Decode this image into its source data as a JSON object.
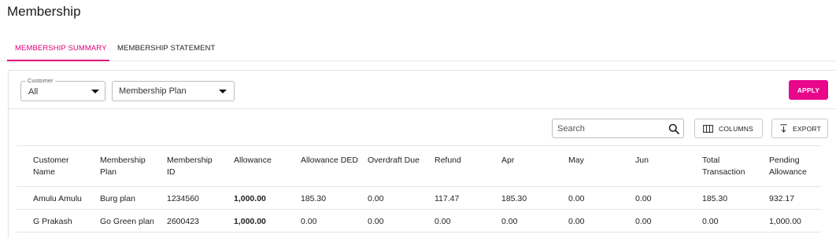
{
  "page": {
    "title": "Membership"
  },
  "tabs": [
    {
      "label": "MEMBERSHIP SUMMARY",
      "active": true
    },
    {
      "label": "MEMBERSHIP STATEMENT",
      "active": false
    }
  ],
  "filters": {
    "customer": {
      "label": "Customer",
      "value": "All"
    },
    "plan": {
      "value": "Membership Plan"
    },
    "apply_label": "APPLY"
  },
  "toolbar": {
    "search_placeholder": "Search",
    "columns_label": "COLUMNS",
    "export_label": "EXPORT"
  },
  "table": {
    "headers": [
      "Customer\nName",
      "Membership\nPlan",
      "Membership\nID",
      "Allowance",
      "Allowance DED",
      "Overdraft Due",
      "Refund",
      "Apr",
      "May",
      "Jun",
      "Total\nTransaction",
      "Pending\nAllowance"
    ],
    "rows": [
      [
        "Amulu Amulu",
        "Burg plan",
        "1234560",
        "1,000.00",
        "185.30",
        "0.00",
        "117.47",
        "185.30",
        "0.00",
        "0.00",
        "185.30",
        "932.17"
      ],
      [
        "G Prakash",
        "Go Green plan",
        "2600423",
        "1,000.00",
        "0.00",
        "0.00",
        "0.00",
        "0.00",
        "0.00",
        "0.00",
        "0.00",
        "1,000.00"
      ]
    ]
  },
  "colors": {
    "accent": "#e8068a",
    "tab_active": "#e0007a",
    "border": "#e6e6e6"
  },
  "icons": {
    "search": "search-icon",
    "columns": "columns-icon",
    "export": "export-icon",
    "dropdown": "chevron-down-icon"
  }
}
